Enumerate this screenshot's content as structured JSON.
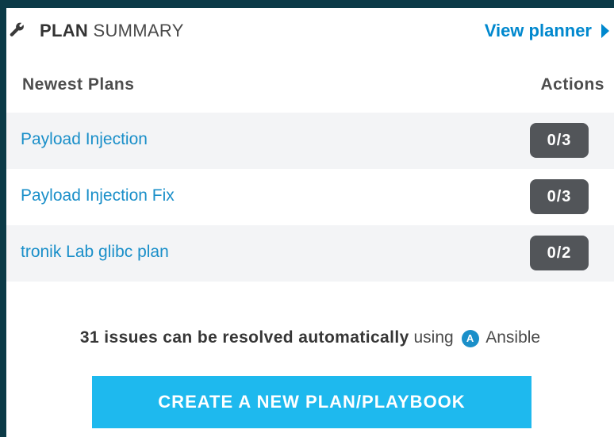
{
  "header": {
    "icon": "wrench-icon",
    "title_bold": "PLAN",
    "title_light": "SUMMARY",
    "view_planner_label": "View planner",
    "view_planner_icon": "caret-right-icon"
  },
  "table": {
    "columns": [
      "Newest Plans",
      "Actions"
    ],
    "rows": [
      {
        "name": "Payload Injection",
        "actions": "0/3"
      },
      {
        "name": "Payload Injection Fix",
        "actions": "0/3"
      },
      {
        "name": "tronik Lab glibc plan",
        "actions": "0/2"
      }
    ]
  },
  "summary": {
    "issues_text": "31 issues can be resolved automatically",
    "using_text": "using",
    "ansible_icon": "ansible-icon",
    "ansible_icon_letter": "A",
    "ansible_label": "Ansible"
  },
  "create_button": {
    "label": "CREATE A NEW PLAN/PLAYBOOK"
  },
  "colors": {
    "page_background": "#0b3a47",
    "link": "#1a8fc9",
    "badge": "#525559",
    "button": "#1eb9ee",
    "row_shade": "#f3f4f6"
  }
}
